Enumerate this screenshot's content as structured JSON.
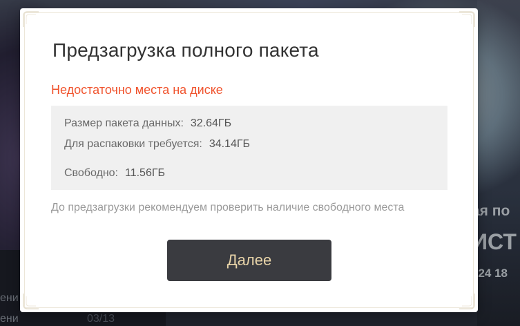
{
  "background": {
    "ticker_line_1": "ени",
    "ticker_line_2": "ени",
    "ticker_date": "03/13",
    "right_text_1": "ая по",
    "right_text_2": "ИСТ",
    "right_text_3": "024 18"
  },
  "dialog": {
    "title": "Предзагрузка полного пакета",
    "warning": "Недостаточно места на диске",
    "info": {
      "package_size_label": "Размер пакета данных:",
      "package_size_value": "32.64ГБ",
      "unpack_required_label": "Для распаковки требуется:",
      "unpack_required_value": "34.14ГБ",
      "free_label": "Свободно:",
      "free_value": "11.56ГБ"
    },
    "note": "До предзагрузки рекомендуем проверить наличие свободного места",
    "next_button_label": "Далее"
  },
  "colors": {
    "warning": "#f0532d",
    "button_bg": "#3a3b40",
    "button_text": "#e7d3a8",
    "info_box_bg": "#f0f0f0"
  }
}
